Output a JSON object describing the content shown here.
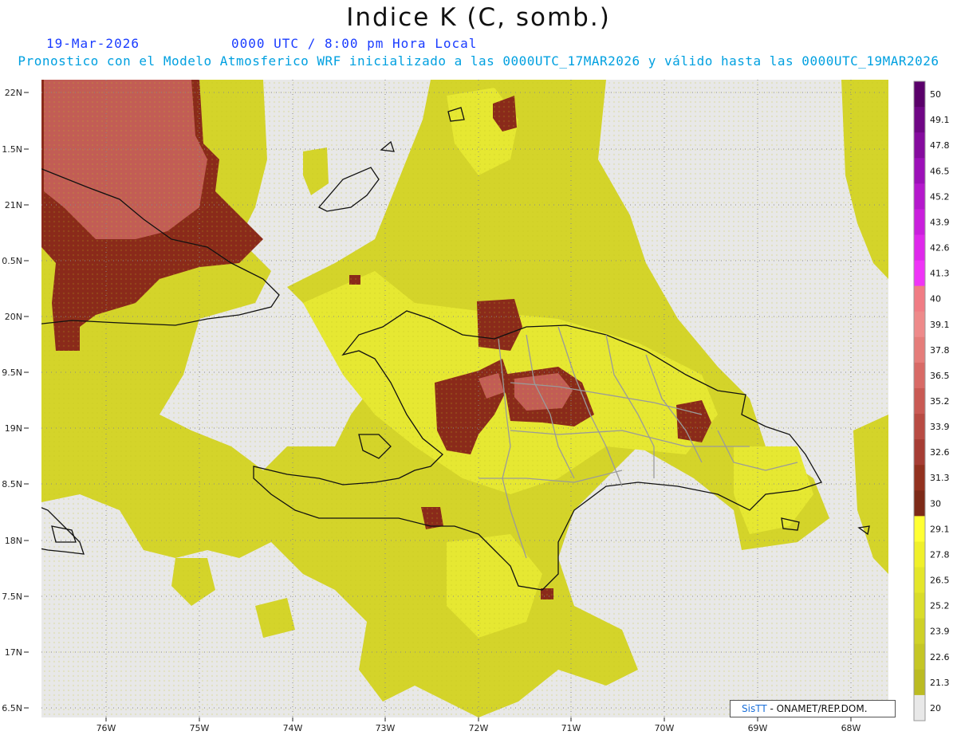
{
  "title": "Indice K (C, somb.)",
  "date": "19-Mar-2026",
  "time": "0000 UTC / 8:00 pm Hora Local",
  "forecast_line": "Pronostico con el Modelo Atmosferico WRF inicializado a las 0000UTC_17MAR2026 y válido hasta las  0000UTC_19MAR2026",
  "lat_labels": [
    "22N",
    "1.5N",
    "21N",
    "0.5N",
    "20N",
    "9.5N",
    "19N",
    "8.5N",
    "18N",
    "7.5N",
    "17N",
    "6.5N"
  ],
  "lon_labels": [
    "76W",
    "75W",
    "74W",
    "73W",
    "72W",
    "71W",
    "70W",
    "69W",
    "68W"
  ],
  "colorbar": {
    "labels": [
      "50",
      "49.1",
      "47.8",
      "46.5",
      "45.2",
      "43.9",
      "42.6",
      "41.3",
      "40",
      "39.1",
      "37.8",
      "36.5",
      "35.2",
      "33.9",
      "32.6",
      "31.3",
      "30",
      "29.1",
      "27.8",
      "26.5",
      "25.2",
      "23.9",
      "22.6",
      "21.3",
      "20"
    ],
    "colors": [
      "#5a006a",
      "#6f0685",
      "#850b9e",
      "#9c10b8",
      "#b418cc",
      "#c91fdc",
      "#de28eb",
      "#ef34f7",
      "#f07c84",
      "#ee8a8a",
      "#e57d7a",
      "#d86a66",
      "#c95a54",
      "#b84b43",
      "#a63d34",
      "#92311f",
      "#7d2a18",
      "#ffff33",
      "#f0f02a",
      "#e4e62a",
      "#d9dc29",
      "#cfd127",
      "#c5c625",
      "#bbbb22",
      "#e8e8e8"
    ]
  },
  "credit": {
    "brand": "SisTT",
    "text": " - ONAMET/REP.DOM."
  }
}
